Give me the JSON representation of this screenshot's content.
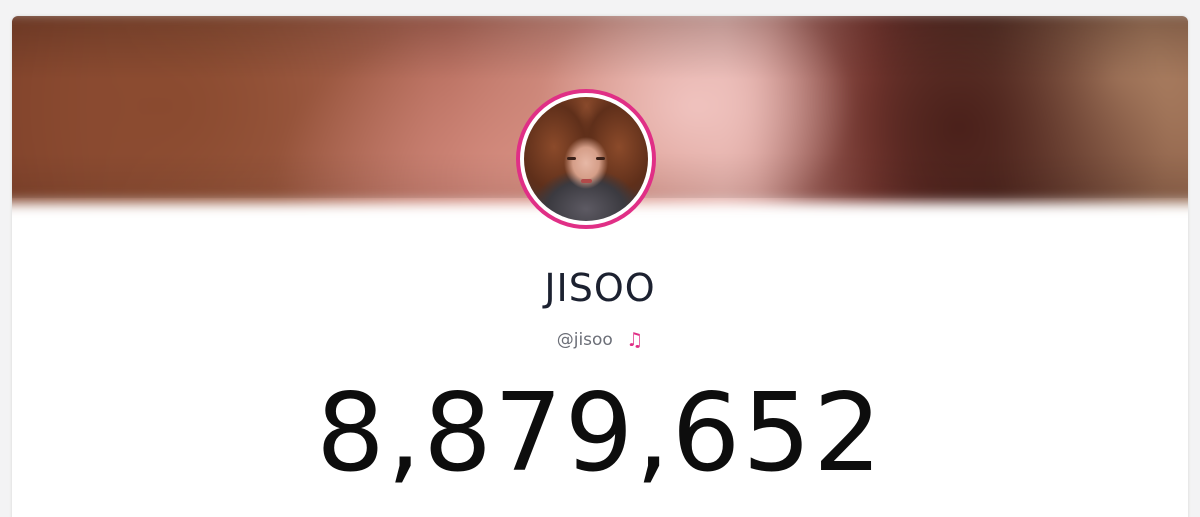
{
  "profile": {
    "name": "JISOO",
    "handle": "@jisoo",
    "badge_icon": "music-note-icon",
    "badge_glyph": "♫",
    "count": "8,879,652"
  },
  "colors": {
    "accent": "#e02f86",
    "name_text": "#1c2130",
    "handle_text": "#6c6f78",
    "count_text": "#0d0d0d"
  }
}
